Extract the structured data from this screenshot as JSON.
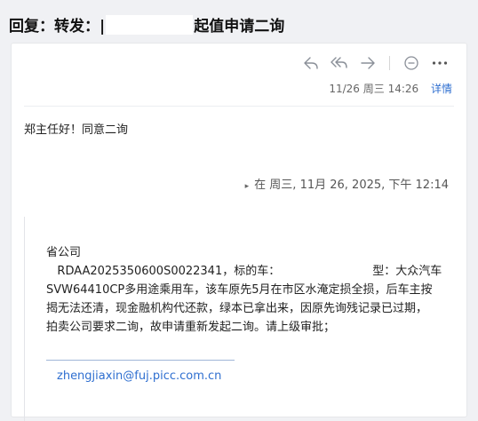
{
  "subject": {
    "prefix": "回复：转发：",
    "initial": "|",
    "suffix": "起值申请二询"
  },
  "toolbar": {
    "icons": [
      "reply-icon",
      "reply-all-icon",
      "forward-icon",
      "comment-icon",
      "more-icon"
    ]
  },
  "meta": {
    "date": "11/26 周三 14:26",
    "detail_link": "详情"
  },
  "body": {
    "greeting": "郑主任好！同意二询"
  },
  "quote": {
    "header": "在 周三, 11月 26, 2025, 下午 12:14",
    "lines": {
      "line1": "省公司",
      "line2_a": "RDAA2025350600S0022341，标的车：",
      "line2_b": "型：大众汽车",
      "line3": "SVW64410CP多用途乘用车，该车原先5月在市区水淹定损全损，后车主按",
      "line4": "揭无法还清，现金融机构代还款，绿本已拿出来，因原先询残记录已过期，",
      "line5": "拍卖公司要求二询，故申请重新发起二询。请上级审批；"
    },
    "email": "zhengjiaxin@fuj.picc.com.cn"
  }
}
